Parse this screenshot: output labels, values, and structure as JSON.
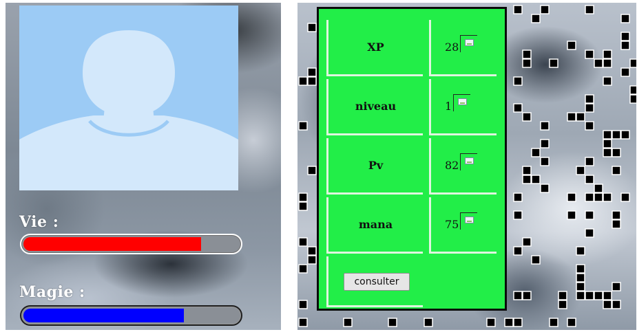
{
  "player": {
    "avatar_icon": "person-silhouette-icon",
    "avatar_bg_color": "#9ccbf5",
    "vie_label": "Vie :",
    "vie_fraction": 0.83,
    "vie_color": "#ff0000",
    "magie_label": "Magie :",
    "magie_fraction": 0.75,
    "magie_color": "#0000ff"
  },
  "stats": {
    "panel_color": "#22ee48",
    "rows": [
      {
        "name": "XP",
        "value": "28"
      },
      {
        "name": "niveau",
        "value": "1"
      },
      {
        "name": "Pv",
        "value": "82"
      },
      {
        "name": "mana",
        "value": "75"
      }
    ],
    "value_icon": "broken-image-icon",
    "consult_label": "consulter"
  }
}
